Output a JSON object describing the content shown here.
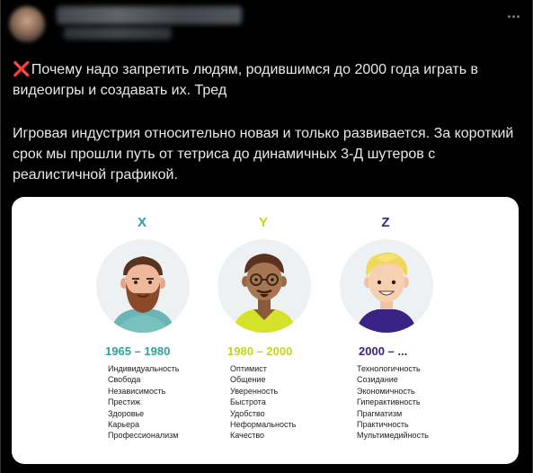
{
  "post": {
    "paragraph1": "Почему надо запретить людям, родившимся до 2000 года играть в видеоигры и создавать их. Тред",
    "paragraph2": "Игровая индустрия относительно новая и только развивается. За короткий срок мы прошли путь от тетриса до динамичных 3-Д шутеров с реалистичной графикой.",
    "x_mark": "❌",
    "x_mark_color": "#f91880"
  },
  "generations": [
    {
      "letter": "X",
      "years": "1965 – 1980",
      "color": "#2aa39b",
      "traits": [
        "Индивидуальность",
        "Свобода",
        "Независимость",
        "Престиж",
        "Здоровье",
        "Карьера",
        "Профессионализм"
      ]
    },
    {
      "letter": "Y",
      "years": "1980 – 2000",
      "color": "#c3d61a",
      "traits": [
        "Оптимист",
        "Общение",
        "Уверенность",
        "Быстрота",
        "Удобство",
        "Неформальность",
        "Качество"
      ]
    },
    {
      "letter": "Z",
      "years": "2000 – ...",
      "color": "#3b2385",
      "traits": [
        "Технологичность",
        "Созидание",
        "Экономичность",
        "Гиперактивность",
        "Прагматизм",
        "Практичность",
        "Мультимедийность"
      ]
    }
  ],
  "colors": {
    "background": "#000000",
    "text": "#e7e9ea",
    "muted": "#71767b",
    "border": "#2f3336"
  },
  "icons": {
    "more": "more-horizontal-icon"
  }
}
